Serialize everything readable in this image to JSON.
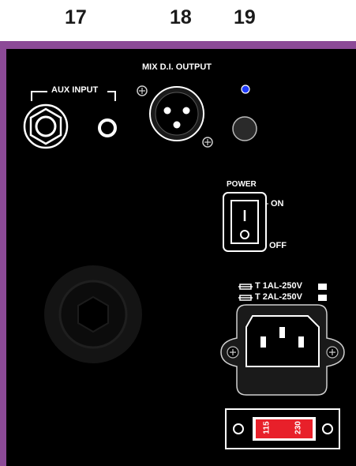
{
  "callouts": {
    "n17": "17",
    "n18": "18",
    "n19": "19"
  },
  "panel": {
    "aux_input_label": "AUX INPUT",
    "mix_di_output_label": "MIX D.I. OUTPUT",
    "power_label": "POWER",
    "on_label": "ON",
    "off_label": "OFF",
    "switch_on_mark": "I",
    "switch_off_mark": "O",
    "fuse_1": "T 1AL-250V",
    "fuse_2": "T 2AL-250V",
    "voltage_115": "115",
    "voltage_230": "230"
  },
  "colors": {
    "panel_border": "#8c4a97",
    "panel": "#000000",
    "led": "#1f3bff",
    "voltage_selector": "#e8202a"
  },
  "icons": [
    "jack-input-icon",
    "rca-input-icon",
    "xlr-output-icon",
    "led-icon",
    "ground-lift-button-icon",
    "rocker-switch-icon",
    "speakon-jack-icon",
    "iec-power-inlet-icon",
    "fuse-icon",
    "voltage-selector-icon"
  ]
}
